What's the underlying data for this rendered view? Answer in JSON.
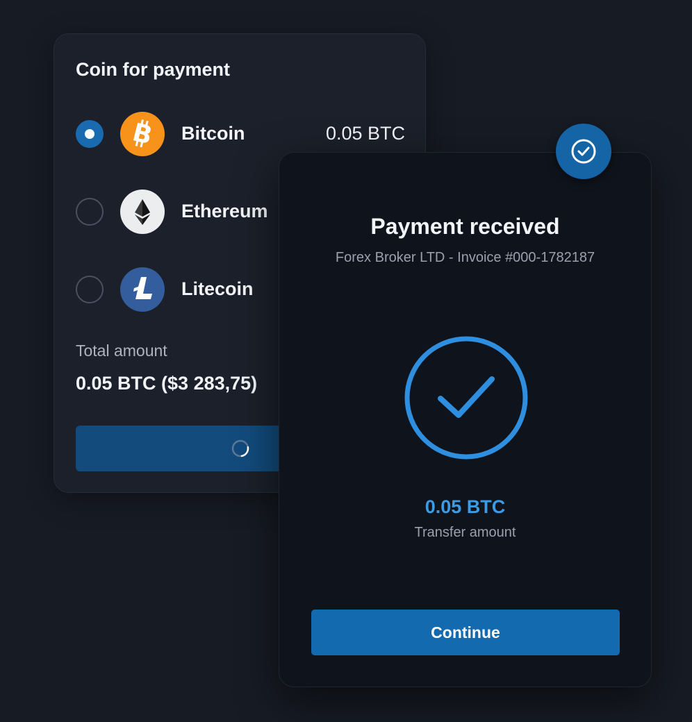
{
  "coin_card": {
    "title": "Coin for payment",
    "coins": [
      {
        "name": "Bitcoin",
        "amount": "0.05 BTC",
        "selected": true,
        "logo_icon": "bitcoin-icon",
        "logo_color": "#f7931a"
      },
      {
        "name": "Ethereum",
        "amount": "",
        "selected": false,
        "logo_icon": "ethereum-icon",
        "logo_color": "#ecedef"
      },
      {
        "name": "Litecoin",
        "amount": "",
        "selected": false,
        "logo_icon": "litecoin-icon",
        "logo_color": "#345d9d"
      }
    ],
    "total_label": "Total amount",
    "total_value": "0.05 BTC ($3 283,75)",
    "pay_button_state": "loading"
  },
  "receipt_card": {
    "title": "Payment received",
    "subtitle": "Forex Broker LTD - Invoice #000-1782187",
    "transfer_amount": "0.05 BTC",
    "transfer_label": "Transfer amount",
    "continue_label": "Continue"
  },
  "colors": {
    "background": "#171b24",
    "accent": "#136aaf",
    "accent_text": "#3c9be6",
    "bitcoin": "#f7931a",
    "litecoin": "#345d9d"
  }
}
